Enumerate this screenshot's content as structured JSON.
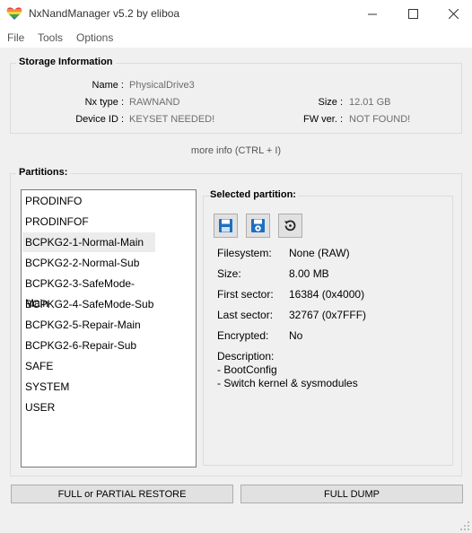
{
  "window": {
    "title": "NxNandManager v5.2 by eliboa"
  },
  "menu": {
    "items": [
      "File",
      "Tools",
      "Options"
    ]
  },
  "storage_info": {
    "title": "Storage Information",
    "name_label": "Name :",
    "name_value": "PhysicalDrive3",
    "type_label": "Nx type :",
    "type_value": "RAWNAND",
    "device_label": "Device ID :",
    "device_value": "KEYSET NEEDED!",
    "size_label": "Size :",
    "size_value": "12.01 GB",
    "fw_label": "FW ver. :",
    "fw_value": "NOT FOUND!"
  },
  "more_info": "more info (CTRL + I)",
  "partitions": {
    "title": "Partitions:",
    "items": [
      "PRODINFO",
      "PRODINFOF",
      "BCPKG2-1-Normal-Main",
      "BCPKG2-2-Normal-Sub",
      "BCPKG2-3-SafeMode-Main",
      "BCPKG2-4-SafeMode-Sub",
      "BCPKG2-5-Repair-Main",
      "BCPKG2-6-Repair-Sub",
      "SAFE",
      "SYSTEM",
      "USER"
    ],
    "selected": "BCPKG2-1-Normal-Main"
  },
  "selected_partition": {
    "title": "Selected partition:",
    "tools": [
      "save-icon",
      "save-options-icon",
      "restore-icon"
    ],
    "filesystem_label": "Filesystem:",
    "filesystem_value": "None (RAW)",
    "size_label": "Size:",
    "size_value": "8.00 MB",
    "first_sector_label": "First sector:",
    "first_sector_value": "16384 (0x4000)",
    "last_sector_label": "Last sector:",
    "last_sector_value": "32767 (0x7FFF)",
    "encrypted_label": "Encrypted:",
    "encrypted_value": "No",
    "description_label": "Description:",
    "description_lines": [
      "- BootConfig",
      "- Switch kernel & sysmodules"
    ]
  },
  "buttons": {
    "restore": "FULL or PARTIAL RESTORE",
    "dump": "FULL DUMP"
  },
  "colors": {
    "heart_top": "#e8413c",
    "heart_mid": "#f3b53f",
    "heart_low": "#3fa24a",
    "save_blue": "#1e6fc0"
  }
}
